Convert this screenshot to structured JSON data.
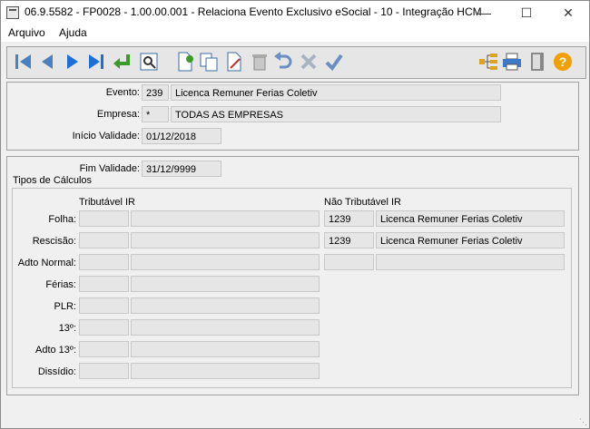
{
  "window": {
    "title": "06.9.5582 - FP0028 - 1.00.00.001 - Relaciona Evento Exclusivo eSocial - 10 - Integração HCM"
  },
  "menu": {
    "items": [
      "Arquivo",
      "Ajuda"
    ]
  },
  "toolbar": {
    "buttons": [
      "first-icon",
      "prev-icon",
      "next-icon",
      "last-icon",
      "confirm-enter-icon",
      "preview-icon",
      "new-icon",
      "copy-icon",
      "edit-icon",
      "delete-icon",
      "undo-icon",
      "cancel-icon",
      "ok-icon",
      "tree-icon",
      "print-icon",
      "exit-icon",
      "help-icon"
    ]
  },
  "header": {
    "evento_label": "Evento:",
    "evento_code": "239",
    "evento_desc": "Licenca Remuner Ferias Coletiv",
    "empresa_label": "Empresa:",
    "empresa_code": "*",
    "empresa_desc": "TODAS AS EMPRESAS",
    "inicio_label": "Início Validade:",
    "inicio_value": "01/12/2018"
  },
  "detail": {
    "fim_label": "Fim Validade:",
    "fim_value": "31/12/9999",
    "group_title": "Tipos de Cálculos",
    "col_tributavel": "Tributável IR",
    "col_nao_tributavel": "Não Tributável IR",
    "rows": [
      {
        "label": "Folha:",
        "trib_code": "",
        "trib_desc": "",
        "nao_code": "1239",
        "nao_desc": "Licenca Remuner Ferias Coletiv"
      },
      {
        "label": "Rescisão:",
        "trib_code": "",
        "trib_desc": "",
        "nao_code": "1239",
        "nao_desc": "Licenca Remuner Ferias Coletiv"
      },
      {
        "label": "Adto Normal:",
        "trib_code": "",
        "trib_desc": "",
        "nao_code": "",
        "nao_desc": ""
      },
      {
        "label": "Férias:",
        "trib_code": "",
        "trib_desc": ""
      },
      {
        "label": "PLR:",
        "trib_code": "",
        "trib_desc": ""
      },
      {
        "label": "13º:",
        "trib_code": "",
        "trib_desc": ""
      },
      {
        "label": "Adto 13º:",
        "trib_code": "",
        "trib_desc": ""
      },
      {
        "label": "Dissídio:",
        "trib_code": "",
        "trib_desc": ""
      }
    ]
  }
}
